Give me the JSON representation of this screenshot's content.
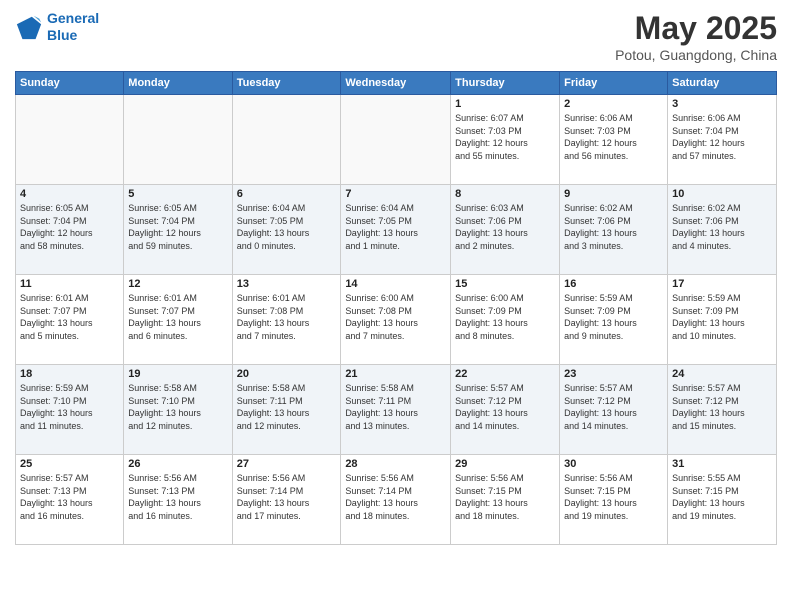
{
  "header": {
    "logo_line1": "General",
    "logo_line2": "Blue",
    "month_title": "May 2025",
    "subtitle": "Potou, Guangdong, China"
  },
  "weekdays": [
    "Sunday",
    "Monday",
    "Tuesday",
    "Wednesday",
    "Thursday",
    "Friday",
    "Saturday"
  ],
  "weeks": [
    [
      {
        "day": "",
        "info": ""
      },
      {
        "day": "",
        "info": ""
      },
      {
        "day": "",
        "info": ""
      },
      {
        "day": "",
        "info": ""
      },
      {
        "day": "1",
        "info": "Sunrise: 6:07 AM\nSunset: 7:03 PM\nDaylight: 12 hours\nand 55 minutes."
      },
      {
        "day": "2",
        "info": "Sunrise: 6:06 AM\nSunset: 7:03 PM\nDaylight: 12 hours\nand 56 minutes."
      },
      {
        "day": "3",
        "info": "Sunrise: 6:06 AM\nSunset: 7:04 PM\nDaylight: 12 hours\nand 57 minutes."
      }
    ],
    [
      {
        "day": "4",
        "info": "Sunrise: 6:05 AM\nSunset: 7:04 PM\nDaylight: 12 hours\nand 58 minutes."
      },
      {
        "day": "5",
        "info": "Sunrise: 6:05 AM\nSunset: 7:04 PM\nDaylight: 12 hours\nand 59 minutes."
      },
      {
        "day": "6",
        "info": "Sunrise: 6:04 AM\nSunset: 7:05 PM\nDaylight: 13 hours\nand 0 minutes."
      },
      {
        "day": "7",
        "info": "Sunrise: 6:04 AM\nSunset: 7:05 PM\nDaylight: 13 hours\nand 1 minute."
      },
      {
        "day": "8",
        "info": "Sunrise: 6:03 AM\nSunset: 7:06 PM\nDaylight: 13 hours\nand 2 minutes."
      },
      {
        "day": "9",
        "info": "Sunrise: 6:02 AM\nSunset: 7:06 PM\nDaylight: 13 hours\nand 3 minutes."
      },
      {
        "day": "10",
        "info": "Sunrise: 6:02 AM\nSunset: 7:06 PM\nDaylight: 13 hours\nand 4 minutes."
      }
    ],
    [
      {
        "day": "11",
        "info": "Sunrise: 6:01 AM\nSunset: 7:07 PM\nDaylight: 13 hours\nand 5 minutes."
      },
      {
        "day": "12",
        "info": "Sunrise: 6:01 AM\nSunset: 7:07 PM\nDaylight: 13 hours\nand 6 minutes."
      },
      {
        "day": "13",
        "info": "Sunrise: 6:01 AM\nSunset: 7:08 PM\nDaylight: 13 hours\nand 7 minutes."
      },
      {
        "day": "14",
        "info": "Sunrise: 6:00 AM\nSunset: 7:08 PM\nDaylight: 13 hours\nand 7 minutes."
      },
      {
        "day": "15",
        "info": "Sunrise: 6:00 AM\nSunset: 7:09 PM\nDaylight: 13 hours\nand 8 minutes."
      },
      {
        "day": "16",
        "info": "Sunrise: 5:59 AM\nSunset: 7:09 PM\nDaylight: 13 hours\nand 9 minutes."
      },
      {
        "day": "17",
        "info": "Sunrise: 5:59 AM\nSunset: 7:09 PM\nDaylight: 13 hours\nand 10 minutes."
      }
    ],
    [
      {
        "day": "18",
        "info": "Sunrise: 5:59 AM\nSunset: 7:10 PM\nDaylight: 13 hours\nand 11 minutes."
      },
      {
        "day": "19",
        "info": "Sunrise: 5:58 AM\nSunset: 7:10 PM\nDaylight: 13 hours\nand 12 minutes."
      },
      {
        "day": "20",
        "info": "Sunrise: 5:58 AM\nSunset: 7:11 PM\nDaylight: 13 hours\nand 12 minutes."
      },
      {
        "day": "21",
        "info": "Sunrise: 5:58 AM\nSunset: 7:11 PM\nDaylight: 13 hours\nand 13 minutes."
      },
      {
        "day": "22",
        "info": "Sunrise: 5:57 AM\nSunset: 7:12 PM\nDaylight: 13 hours\nand 14 minutes."
      },
      {
        "day": "23",
        "info": "Sunrise: 5:57 AM\nSunset: 7:12 PM\nDaylight: 13 hours\nand 14 minutes."
      },
      {
        "day": "24",
        "info": "Sunrise: 5:57 AM\nSunset: 7:12 PM\nDaylight: 13 hours\nand 15 minutes."
      }
    ],
    [
      {
        "day": "25",
        "info": "Sunrise: 5:57 AM\nSunset: 7:13 PM\nDaylight: 13 hours\nand 16 minutes."
      },
      {
        "day": "26",
        "info": "Sunrise: 5:56 AM\nSunset: 7:13 PM\nDaylight: 13 hours\nand 16 minutes."
      },
      {
        "day": "27",
        "info": "Sunrise: 5:56 AM\nSunset: 7:14 PM\nDaylight: 13 hours\nand 17 minutes."
      },
      {
        "day": "28",
        "info": "Sunrise: 5:56 AM\nSunset: 7:14 PM\nDaylight: 13 hours\nand 18 minutes."
      },
      {
        "day": "29",
        "info": "Sunrise: 5:56 AM\nSunset: 7:15 PM\nDaylight: 13 hours\nand 18 minutes."
      },
      {
        "day": "30",
        "info": "Sunrise: 5:56 AM\nSunset: 7:15 PM\nDaylight: 13 hours\nand 19 minutes."
      },
      {
        "day": "31",
        "info": "Sunrise: 5:55 AM\nSunset: 7:15 PM\nDaylight: 13 hours\nand 19 minutes."
      }
    ]
  ]
}
